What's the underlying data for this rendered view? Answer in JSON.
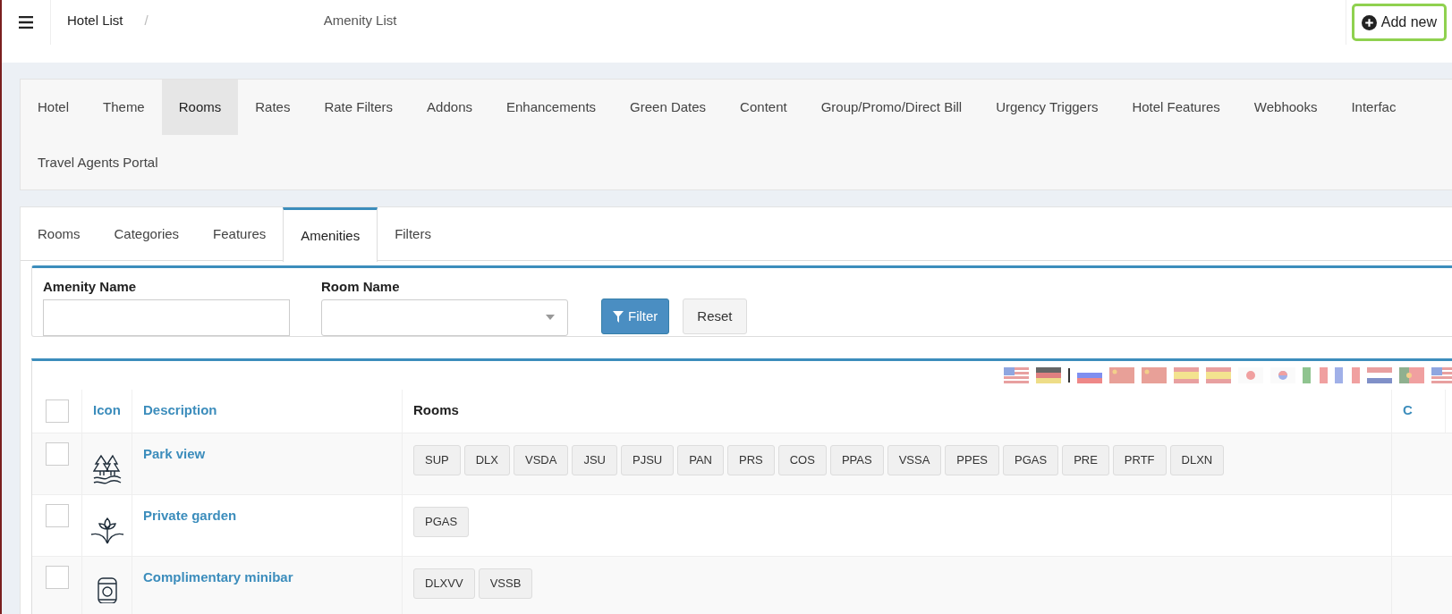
{
  "header": {
    "breadcrumbs": [
      {
        "label": "Hotel List"
      },
      {
        "label": "Amenity List"
      }
    ],
    "separator": "/",
    "add_button": "Add new"
  },
  "main_tabs": [
    {
      "label": "Hotel",
      "selected": false
    },
    {
      "label": "Theme",
      "selected": false
    },
    {
      "label": "Rooms",
      "selected": true
    },
    {
      "label": "Rates",
      "selected": false
    },
    {
      "label": "Rate Filters",
      "selected": false
    },
    {
      "label": "Addons",
      "selected": false
    },
    {
      "label": "Enhancements",
      "selected": false
    },
    {
      "label": "Green Dates",
      "selected": false
    },
    {
      "label": "Content",
      "selected": false
    },
    {
      "label": "Group/Promo/Direct Bill",
      "selected": false
    },
    {
      "label": "Urgency Triggers",
      "selected": false
    },
    {
      "label": "Hotel Features",
      "selected": false
    },
    {
      "label": "Webhooks",
      "selected": false
    },
    {
      "label": "Interfac",
      "selected": false
    },
    {
      "label": "Travel Agents Portal",
      "selected": false
    }
  ],
  "sub_tabs": [
    {
      "label": "Rooms",
      "selected": false
    },
    {
      "label": "Categories",
      "selected": false
    },
    {
      "label": "Features",
      "selected": false
    },
    {
      "label": "Amenities",
      "selected": true
    },
    {
      "label": "Filters",
      "selected": false
    }
  ],
  "filter": {
    "amenity_name": {
      "label": "Amenity Name"
    },
    "room_name": {
      "label": "Room Name"
    },
    "filter_button": "Filter",
    "reset_button": "Reset"
  },
  "table": {
    "select_all_checked": false,
    "columns": [
      "Icon",
      "Description",
      "Rooms",
      "C"
    ],
    "rows": [
      {
        "checked": false,
        "kind": "trees",
        "description": "Park view",
        "rooms": [
          "SUP",
          "DLX",
          "VSDA",
          "JSU",
          "PJSU",
          "PAN",
          "PRS",
          "COS",
          "PPAS",
          "VSSA",
          "PPES",
          "PGAS",
          "PRE",
          "PRTF",
          "DLXN"
        ]
      },
      {
        "checked": false,
        "kind": "plant",
        "description": "Private garden",
        "rooms": [
          "PGAS"
        ]
      },
      {
        "checked": false,
        "kind": "can",
        "description": "Complimentary minibar",
        "rooms": [
          "DLXVV",
          "VSSB"
        ]
      }
    ]
  }
}
